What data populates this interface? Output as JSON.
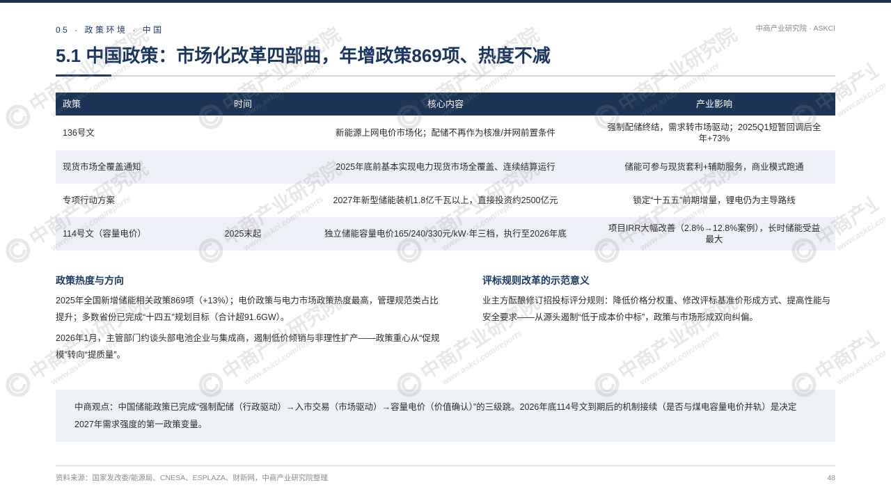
{
  "theme": {
    "navy": "#1c3557",
    "accent": "#1d3a64",
    "row_shade": "#eef1f7"
  },
  "header": {
    "breadcrumb": "05 · 政策环境 · 中国",
    "brand": "中商产业研究院 · ASKCI",
    "title": "5.1 中国政策：市场化改革四部曲，年增政策869项、热度不减"
  },
  "table": {
    "columns": [
      "政策",
      "时间",
      "核心内容",
      "产业影响"
    ],
    "rows": [
      [
        "136号文",
        "",
        "新能源上网电价市场化；配储不再作为核准/并网前置条件",
        "强制配储终结，需求转市场驱动；2025Q1短暂回调后全年+73%"
      ],
      [
        "现货市场全覆盖通知",
        "",
        "2025年底前基本实现电力现货市场全覆盖、连续结算运行",
        "储能可参与现货套利+辅助服务，商业模式跑通"
      ],
      [
        "专项行动方案",
        "",
        "2027年新型储能装机1.8亿千瓦以上，直接投资约2500亿元",
        "锁定“十五五”前期增量，锂电仍为主导路线"
      ],
      [
        "114号文（容量电价）",
        "2025末起",
        "独立储能容量电价165/240/330元/kW·年三档，执行至2026年底",
        "项目IRR大幅改善（2.8%→12.8%案例），长时储能受益最大"
      ]
    ]
  },
  "left_section": {
    "heading": "政策热度与方向",
    "paragraphs": [
      "2025年全国新增储能相关政策869项（+13%）；电价政策与电力市场政策热度最高，管理规范类占比提升；多数省份已完成“十四五”规划目标（合计超91.6GW）。",
      "2026年1月，主管部门约谈头部电池企业与集成商，遏制低价倾销与非理性扩产——政策重心从“促规模”转向“提质量”。"
    ]
  },
  "right_section": {
    "heading": "评标规则改革的示范意义",
    "paragraphs": [
      "业主方酝酿修订招投标评分规则：降低价格分权重、修改评标基准价形成方式、提高性能与安全要求——从源头遏制“低于成本价中标”，政策与市场形成双向纠偏。"
    ]
  },
  "callout": {
    "text": "中商观点：中国储能政策已完成“强制配储（行政驱动）→入市交易（市场驱动）→容量电价（价值确认）”的三级跳。2026年底114号文到期后的机制接续（是否与煤电容量电价并轨）是决定2027年需求强度的第一政策变量。"
  },
  "footer": {
    "source": "资料来源：国家发改委/能源局、CNESA、ESPLAZA、财新网，中商产业研究院整理",
    "page_number": "48"
  },
  "watermark": {
    "name": "中商产业研究院",
    "url": "www.askci.com/reports",
    "logo_icon": "askci-logo-icon"
  }
}
